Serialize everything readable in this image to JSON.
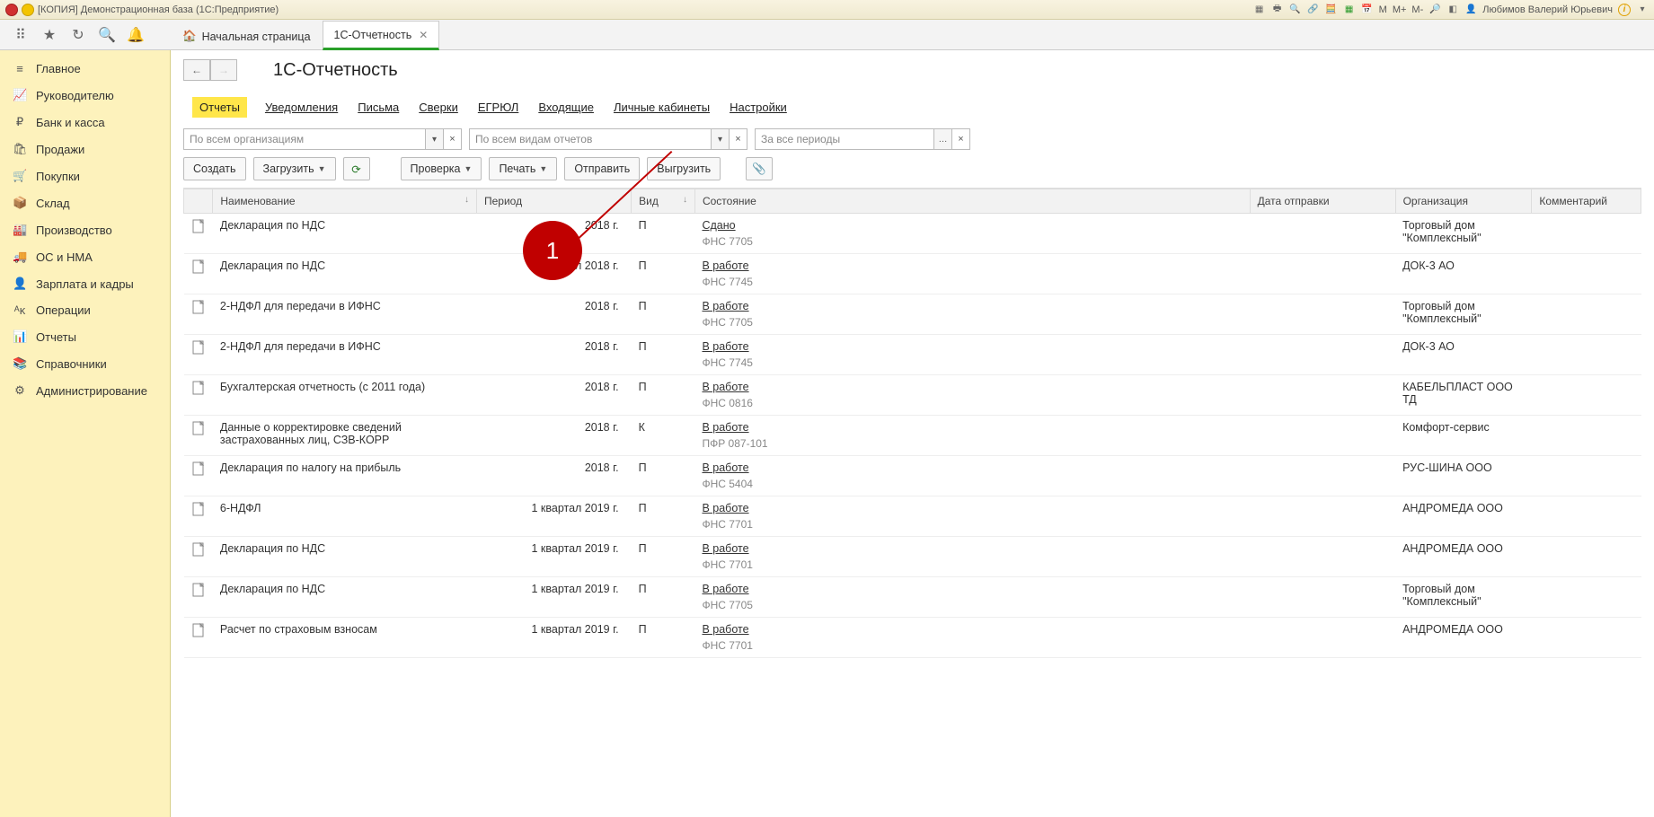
{
  "titlebar": {
    "title": "[КОПИЯ] Демонстрационная база  (1С:Предприятие)",
    "user": "Любимов Валерий Юрьевич",
    "m_items": [
      "M",
      "M+",
      "M-"
    ]
  },
  "tabs": {
    "home": "Начальная страница",
    "active": "1С-Отчетность"
  },
  "sidebar": {
    "items": [
      {
        "icon": "≡",
        "label": "Главное"
      },
      {
        "icon": "📈",
        "label": "Руководителю"
      },
      {
        "icon": "₽",
        "label": "Банк и касса"
      },
      {
        "icon": "🛍",
        "label": "Продажи"
      },
      {
        "icon": "🛒",
        "label": "Покупки"
      },
      {
        "icon": "📦",
        "label": "Склад"
      },
      {
        "icon": "🏭",
        "label": "Производство"
      },
      {
        "icon": "🚚",
        "label": "ОС и НМА"
      },
      {
        "icon": "👤",
        "label": "Зарплата и кадры"
      },
      {
        "icon": "ᴬᴋ",
        "label": "Операции"
      },
      {
        "icon": "📊",
        "label": "Отчеты"
      },
      {
        "icon": "📚",
        "label": "Справочники"
      },
      {
        "icon": "⚙",
        "label": "Администрирование"
      }
    ]
  },
  "page": {
    "title": "1С-Отчетность",
    "subtabs": [
      "Отчеты",
      "Уведомления",
      "Письма",
      "Сверки",
      "ЕГРЮЛ",
      "Входящие",
      "Личные кабинеты",
      "Настройки"
    ],
    "subtab_active": 0,
    "filters": {
      "org": {
        "placeholder": "По всем организациям"
      },
      "type": {
        "placeholder": "По всем видам отчетов"
      },
      "period": {
        "placeholder": "За все периоды"
      }
    },
    "toolbar": {
      "create": "Создать",
      "load": "Загрузить",
      "check": "Проверка",
      "print": "Печать",
      "send": "Отправить",
      "export": "Выгрузить"
    },
    "columns": {
      "name": "Наименование",
      "period": "Период",
      "vid": "Вид",
      "status": "Состояние",
      "date": "Дата отправки",
      "org": "Организация",
      "comment": "Комментарий"
    },
    "rows": [
      {
        "icon": "doc",
        "name": "Декларация по НДС",
        "period": "2018 г.",
        "vid": "П",
        "status": "Сдано",
        "sub": "ФНС 7705",
        "date": "",
        "org": "Торговый дом \"Комплексный\"",
        "comment": ""
      },
      {
        "icon": "doc",
        "name": "Декларация по НДС",
        "period": "4 квартал 2018 г.",
        "vid": "П",
        "status": "В работе",
        "sub": "ФНС 7745",
        "date": "",
        "org": "ДОК-3 АО",
        "comment": ""
      },
      {
        "icon": "doc2",
        "name": "2-НДФЛ для передачи в ИФНС",
        "period": "2018 г.",
        "vid": "П",
        "status": "В работе",
        "sub": "ФНС 7705",
        "date": "",
        "org": "Торговый дом \"Комплексный\"",
        "comment": ""
      },
      {
        "icon": "doc2",
        "name": "2-НДФЛ для передачи в ИФНС",
        "period": "2018 г.",
        "vid": "П",
        "status": "В работе",
        "sub": "ФНС 7745",
        "date": "",
        "org": "ДОК-3 АО",
        "comment": ""
      },
      {
        "icon": "doc2",
        "name": "Бухгалтерская отчетность (с 2011 года)",
        "period": "2018 г.",
        "vid": "П",
        "status": "В работе",
        "sub": "ФНС 0816",
        "date": "",
        "org": "КАБЕЛЬПЛАСТ ООО ТД",
        "comment": ""
      },
      {
        "icon": "doc2",
        "name": "Данные о корректировке сведений застрахованных лиц, СЗВ-КОРР",
        "period": "2018 г.",
        "vid": "К",
        "status": "В работе",
        "sub": "ПФР 087-101",
        "date": "",
        "org": "Комфорт-сервис",
        "comment": ""
      },
      {
        "icon": "doc",
        "name": "Декларация по налогу на прибыль",
        "period": "2018 г.",
        "vid": "П",
        "status": "В работе",
        "sub": "ФНС 5404",
        "date": "",
        "org": "РУС-ШИНА ООО",
        "comment": ""
      },
      {
        "icon": "doc",
        "name": "6-НДФЛ",
        "period": "1 квартал 2019 г.",
        "vid": "П",
        "status": "В работе",
        "sub": "ФНС 7701",
        "date": "",
        "org": "АНДРОМЕДА ООО",
        "comment": ""
      },
      {
        "icon": "doc",
        "name": "Декларация по НДС",
        "period": "1 квартал 2019 г.",
        "vid": "П",
        "status": "В работе",
        "sub": "ФНС 7701",
        "date": "",
        "org": "АНДРОМЕДА ООО",
        "comment": ""
      },
      {
        "icon": "doc",
        "name": "Декларация по НДС",
        "period": "1 квартал 2019 г.",
        "vid": "П",
        "status": "В работе",
        "sub": "ФНС 7705",
        "date": "",
        "org": "Торговый дом \"Комплексный\"",
        "comment": ""
      },
      {
        "icon": "doc",
        "name": "Расчет по страховым взносам",
        "period": "1 квартал 2019 г.",
        "vid": "П",
        "status": "В работе",
        "sub": "ФНС 7701",
        "date": "",
        "org": "АНДРОМЕДА ООО",
        "comment": ""
      }
    ]
  },
  "annotation": {
    "label": "1"
  }
}
